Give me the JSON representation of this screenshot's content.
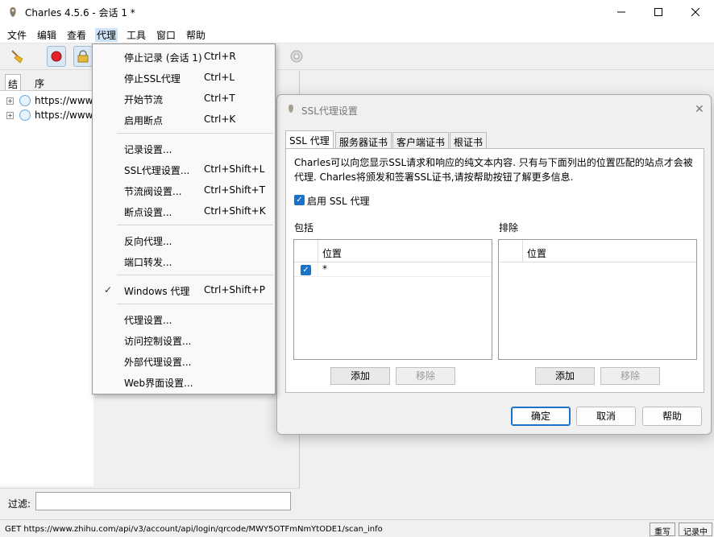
{
  "window": {
    "title": "Charles 4.5.6 - 会话 1 *"
  },
  "menubar": [
    "文件",
    "编辑",
    "查看",
    "代理",
    "工具",
    "窗口",
    "帮助"
  ],
  "left_panel": {
    "tabs": [
      "结构",
      "序列"
    ],
    "rows": [
      "https://www.",
      "https://www."
    ],
    "filter_label": "过滤:"
  },
  "proxy_menu": {
    "items": [
      {
        "label": "停止记录 (会话 1)",
        "shortcut": "Ctrl+R"
      },
      {
        "label": "停止SSL代理",
        "shortcut": "Ctrl+L"
      },
      {
        "label": "开始节流",
        "shortcut": "Ctrl+T"
      },
      {
        "label": "启用断点",
        "shortcut": "Ctrl+K"
      },
      {
        "label": "记录设置...",
        "shortcut": ""
      },
      {
        "label": "SSL代理设置...",
        "shortcut": "Ctrl+Shift+L"
      },
      {
        "label": "节流阀设置...",
        "shortcut": "Ctrl+Shift+T"
      },
      {
        "label": "断点设置...",
        "shortcut": "Ctrl+Shift+K"
      },
      {
        "label": "反向代理...",
        "shortcut": ""
      },
      {
        "label": "端口转发...",
        "shortcut": ""
      },
      {
        "label": "Windows 代理",
        "shortcut": "Ctrl+Shift+P",
        "checked": true
      },
      {
        "label": "代理设置...",
        "shortcut": ""
      },
      {
        "label": "访问控制设置...",
        "shortcut": ""
      },
      {
        "label": "外部代理设置...",
        "shortcut": ""
      },
      {
        "label": "Web界面设置...",
        "shortcut": ""
      }
    ],
    "check_glyph": "✓"
  },
  "dialog": {
    "title": "SSL代理设置",
    "tabs": [
      "SSL 代理",
      "服务器证书",
      "客户端证书",
      "根证书"
    ],
    "description": "Charles可以向您显示SSL请求和响应的纯文本内容. 只有与下面列出的位置匹配的站点才会被代理. Charles将颁发和签署SSL证书,请按帮助按钮了解更多信息.",
    "enable_label": "启用 SSL 代理",
    "include": {
      "label": "包括",
      "column": "位置",
      "rows": [
        "*"
      ],
      "add": "添加",
      "remove": "移除"
    },
    "exclude": {
      "label": "排除",
      "column": "位置",
      "rows": [],
      "add": "添加",
      "remove": "移除"
    },
    "buttons": {
      "ok": "确定",
      "cancel": "取消",
      "help": "帮助"
    }
  },
  "statusbar": {
    "url": "GET https://www.zhihu.com/api/v3/account/api/login/qrcode/MWY5OTFmNmYtODE1/scan_info",
    "rw": "重写",
    "recording": "记录中"
  },
  "colors": {
    "accent": "#1a73c8",
    "record": "#e0202a"
  }
}
